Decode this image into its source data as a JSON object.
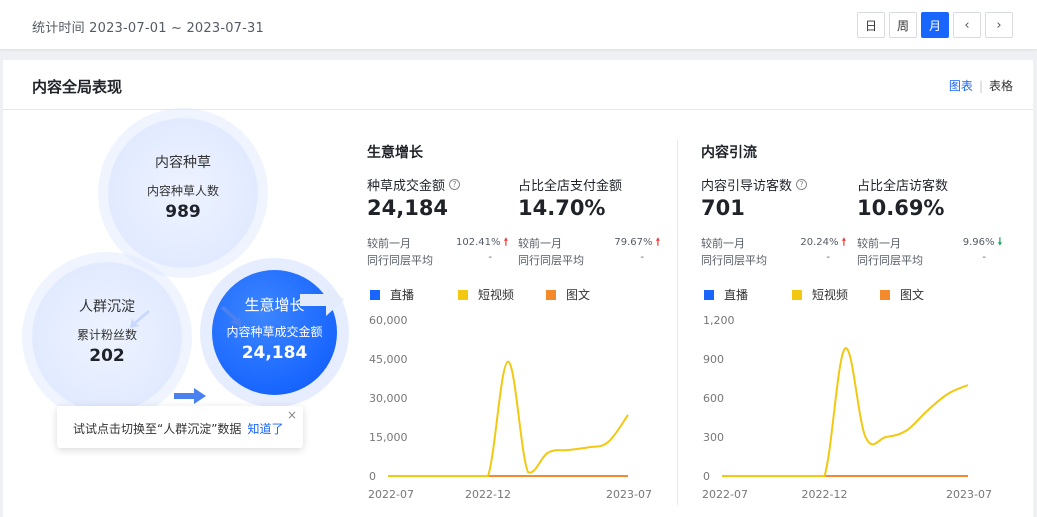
{
  "header": {
    "date_range": "统计时间 2023-07-01 ~ 2023-07-31",
    "range_buttons": [
      "日",
      "周",
      "月"
    ],
    "active_range": "月",
    "prev_icon": "chevron-left-icon",
    "next_icon": "chevron-right-icon"
  },
  "panel": {
    "title": "内容全局表现",
    "view_chart": "图表",
    "view_table": "表格"
  },
  "funnel": {
    "zc": {
      "title": "内容种草",
      "label": "内容种草人数",
      "value": "989"
    },
    "rq": {
      "title": "人群沉淀",
      "label": "累计粉丝数",
      "value": "202"
    },
    "sy": {
      "title": "生意增长",
      "label": "内容种草成交金额",
      "value": "24,184"
    }
  },
  "tip": {
    "text": "试试点击切换至“人群沉淀”数据",
    "link": "知道了",
    "close": "×"
  },
  "business": {
    "title": "生意增长",
    "m1": {
      "label": "种草成交金额",
      "value": "24,184",
      "cmp1_label": "较前一月",
      "cmp1_value": "102.41%",
      "cmp2_label": "同行同层平均",
      "cmp2_value": "-"
    },
    "m2": {
      "label": "占比全店支付金额",
      "value": "14.70%",
      "cmp1_label": "较前一月",
      "cmp1_value": "79.67%",
      "cmp2_label": "同行同层平均",
      "cmp2_value": "-"
    }
  },
  "traffic": {
    "title": "内容引流",
    "m1": {
      "label": "内容引导访客数",
      "value": "701",
      "cmp1_label": "较前一月",
      "cmp1_value": "20.24%",
      "cmp2_label": "同行同层平均",
      "cmp2_value": "-"
    },
    "m2": {
      "label": "占比全店访客数",
      "value": "10.69%",
      "cmp1_label": "较前一月",
      "cmp1_value": "9.96%",
      "cmp2_label": "同行同层平均",
      "cmp2_value": "-"
    }
  },
  "colors": {
    "accent": "#1966ff",
    "up": "#f03a3a",
    "down": "#1aa85c",
    "live": "#1966ff",
    "short_video": "#f2c811",
    "graphic": "#f58a2c"
  },
  "chart_data": [
    {
      "type": "line",
      "series": [
        {
          "name": "直播",
          "color": "#1966ff",
          "values": [
            0,
            0,
            0,
            0,
            0,
            0,
            0,
            0,
            0,
            0,
            0,
            0,
            0
          ]
        },
        {
          "name": "短视频",
          "color": "#f2c811",
          "values": [
            0,
            0,
            0,
            0,
            0,
            0,
            44000,
            1500,
            9000,
            10000,
            11000,
            13000,
            23500
          ]
        },
        {
          "name": "图文",
          "color": "#f58a2c",
          "values": [
            0,
            0,
            0,
            0,
            0,
            0,
            0,
            0,
            0,
            0,
            0,
            0,
            0
          ]
        }
      ],
      "x": [
        "2022-07",
        "2022-08",
        "2022-09",
        "2022-10",
        "2022-11",
        "2022-12",
        "2023-01",
        "2023-02",
        "2023-03",
        "2023-04",
        "2023-05",
        "2023-06",
        "2023-07"
      ],
      "x_ticks": [
        "2022-07",
        "2022-12",
        "2023-07"
      ],
      "y_ticks": [
        "0",
        "15,000",
        "30,000",
        "45,000",
        "60,000"
      ],
      "ylim": [
        0,
        60000
      ],
      "legend": "top-left",
      "grid": false
    },
    {
      "type": "line",
      "series": [
        {
          "name": "直播",
          "color": "#1966ff",
          "values": [
            0,
            0,
            0,
            0,
            0,
            0,
            0,
            0,
            0,
            0,
            0,
            0,
            0
          ]
        },
        {
          "name": "短视频",
          "color": "#f2c811",
          "values": [
            0,
            0,
            0,
            0,
            0,
            0,
            980,
            300,
            300,
            350,
            500,
            630,
            700
          ]
        },
        {
          "name": "图文",
          "color": "#f58a2c",
          "values": [
            0,
            0,
            0,
            0,
            0,
            0,
            0,
            0,
            0,
            0,
            0,
            0,
            0
          ]
        }
      ],
      "x": [
        "2022-07",
        "2022-08",
        "2022-09",
        "2022-10",
        "2022-11",
        "2022-12",
        "2023-01",
        "2023-02",
        "2023-03",
        "2023-04",
        "2023-05",
        "2023-06",
        "2023-07"
      ],
      "x_ticks": [
        "2022-07",
        "2022-12",
        "2023-07"
      ],
      "y_ticks": [
        "0",
        "300",
        "600",
        "900",
        "1,200"
      ],
      "ylim": [
        0,
        1200
      ],
      "legend": "top-left",
      "grid": false
    }
  ]
}
